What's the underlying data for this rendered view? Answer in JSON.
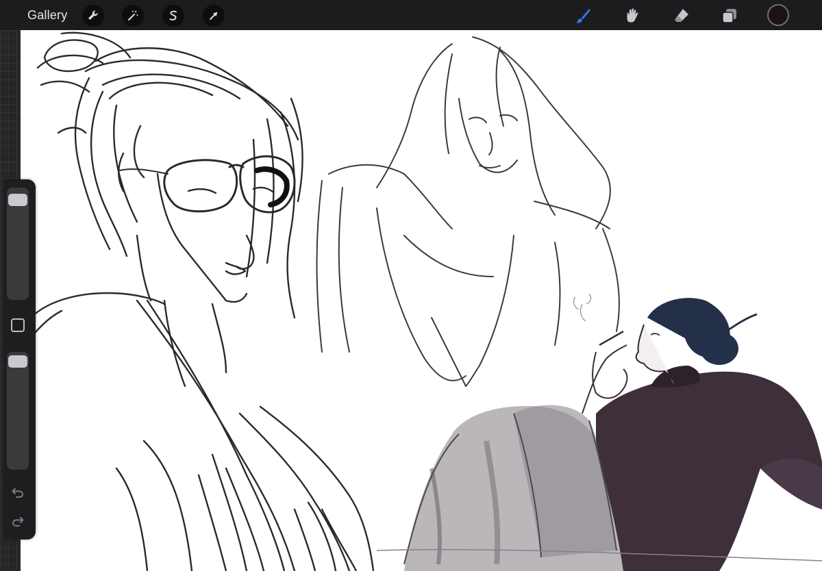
{
  "app": {
    "gallery_label": "Gallery"
  },
  "toolbar": {
    "left_tools": [
      {
        "name": "actions",
        "icon": "wrench-icon"
      },
      {
        "name": "adjustments",
        "icon": "magic-wand-icon"
      },
      {
        "name": "selection",
        "icon": "selection-s-icon"
      },
      {
        "name": "transform",
        "icon": "arrow-cursor-icon"
      }
    ],
    "right_tools": [
      {
        "name": "brush",
        "icon": "brush-icon",
        "active": true
      },
      {
        "name": "smudge",
        "icon": "smudge-icon",
        "active": false
      },
      {
        "name": "eraser",
        "icon": "eraser-icon",
        "active": false
      },
      {
        "name": "layers",
        "icon": "layers-icon",
        "active": false
      }
    ],
    "current_color": "#1a1215",
    "active_color": "#2f7bf5"
  },
  "sidebar": {
    "size_slider_level": 0.05,
    "opacity_slider_level": 0.02,
    "modify_icon": "square-icon",
    "undo_icon": "undo-icon",
    "redo_icon": "redo-icon"
  }
}
